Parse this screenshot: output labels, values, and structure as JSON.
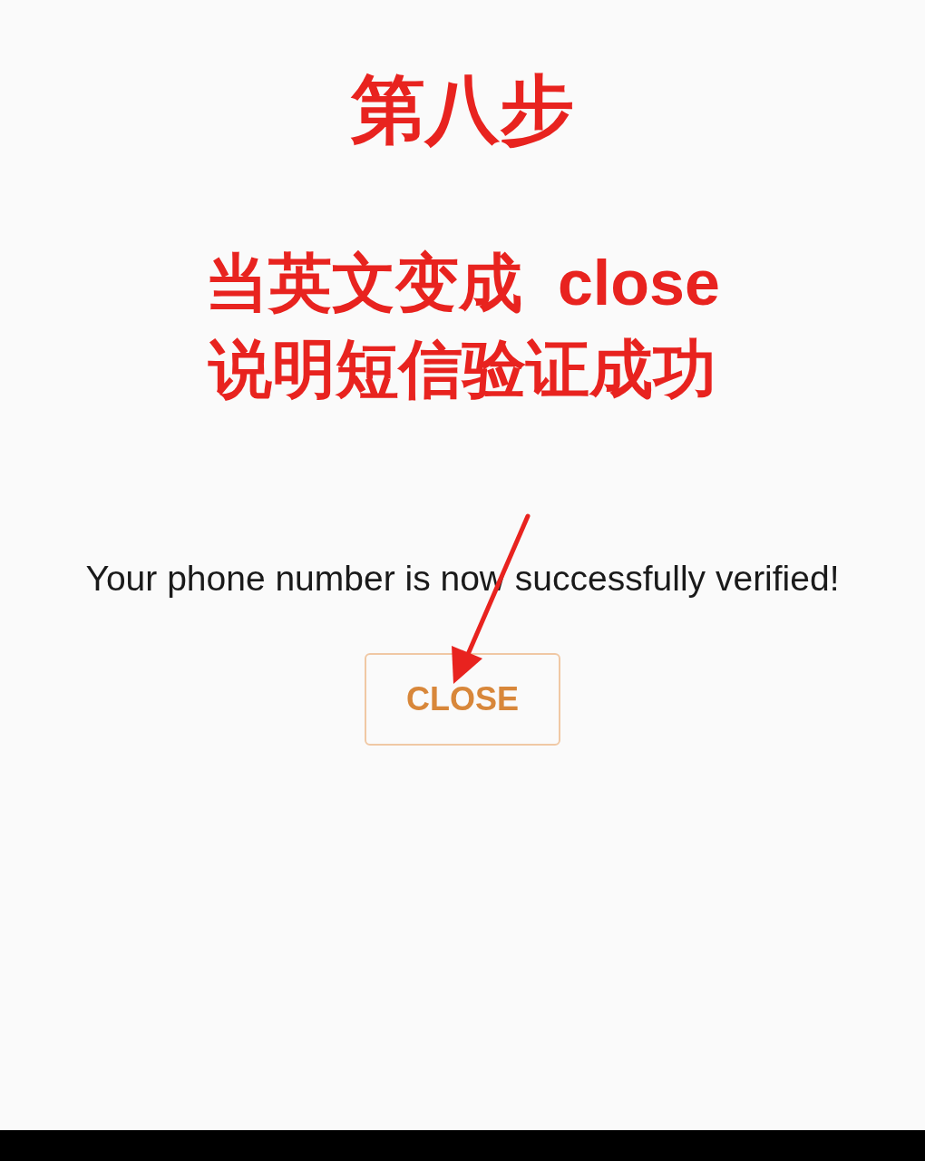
{
  "annotation": {
    "step_title": "第八步",
    "lines": [
      "当英文变成  close",
      "说明短信验证成功"
    ]
  },
  "message": "Your phone number is now successfully verified!",
  "button": {
    "label": "CLOSE"
  }
}
